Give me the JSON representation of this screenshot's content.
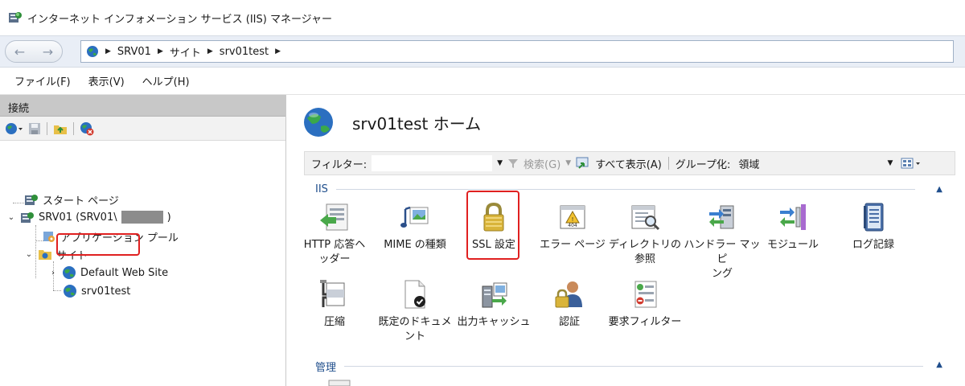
{
  "window": {
    "title": "インターネット インフォメーション サービス (IIS) マネージャー",
    "icon": "iis-manager-icon"
  },
  "address": {
    "breadcrumbs": [
      "SRV01",
      "サイト",
      "srv01test"
    ]
  },
  "menu": {
    "items": [
      "ファイル(F)",
      "表示(V)",
      "ヘルプ(H)"
    ]
  },
  "connections": {
    "header": "接続",
    "tree": {
      "start_page": "スタート ページ",
      "server": "SRV01 (SRV01\\",
      "app_pools": "アプリケーション プール",
      "sites": "サイト",
      "default_site": "Default Web Site",
      "selected_site": "srv01test"
    }
  },
  "main": {
    "title": "srv01test ホーム",
    "filter": {
      "label": "フィルター:",
      "search": "検索(G)",
      "show_all": "すべて表示(A)",
      "group_label": "グループ化:",
      "group_value": "領域"
    },
    "sections": {
      "iis": "IIS",
      "management": "管理"
    },
    "features_row1": [
      {
        "label1": "HTTP 応答ヘ",
        "label2": "ッダー",
        "icon": "http-response-headers-icon"
      },
      {
        "label1": "MIME の種類",
        "label2": "",
        "icon": "mime-types-icon"
      },
      {
        "label1": "SSL 設定",
        "label2": "",
        "icon": "ssl-lock-icon"
      },
      {
        "label1": "エラー ページ",
        "label2": "",
        "icon": "error-pages-icon"
      },
      {
        "label1": "ディレクトリの",
        "label2": "参照",
        "icon": "directory-browsing-icon"
      },
      {
        "label1": "ハンドラー マッピ",
        "label2": "ング",
        "icon": "handler-mappings-icon"
      },
      {
        "label1": "モジュール",
        "label2": "",
        "icon": "modules-icon"
      },
      {
        "label1": "ログ記録",
        "label2": "",
        "icon": "logging-icon"
      }
    ],
    "features_row2": [
      {
        "label1": "圧縮",
        "label2": "",
        "icon": "compression-icon"
      },
      {
        "label1": "既定のドキュメ",
        "label2": "ント",
        "icon": "default-document-icon"
      },
      {
        "label1": "出力キャッシュ",
        "label2": "",
        "icon": "output-caching-icon"
      },
      {
        "label1": "認証",
        "label2": "",
        "icon": "authentication-icon"
      },
      {
        "label1": "要求フィルター",
        "label2": "",
        "icon": "request-filtering-icon"
      }
    ]
  },
  "colors": {
    "selection_highlight": "#e02020",
    "section_text": "#1f4e8c",
    "address_bg": "#e9eef6"
  }
}
